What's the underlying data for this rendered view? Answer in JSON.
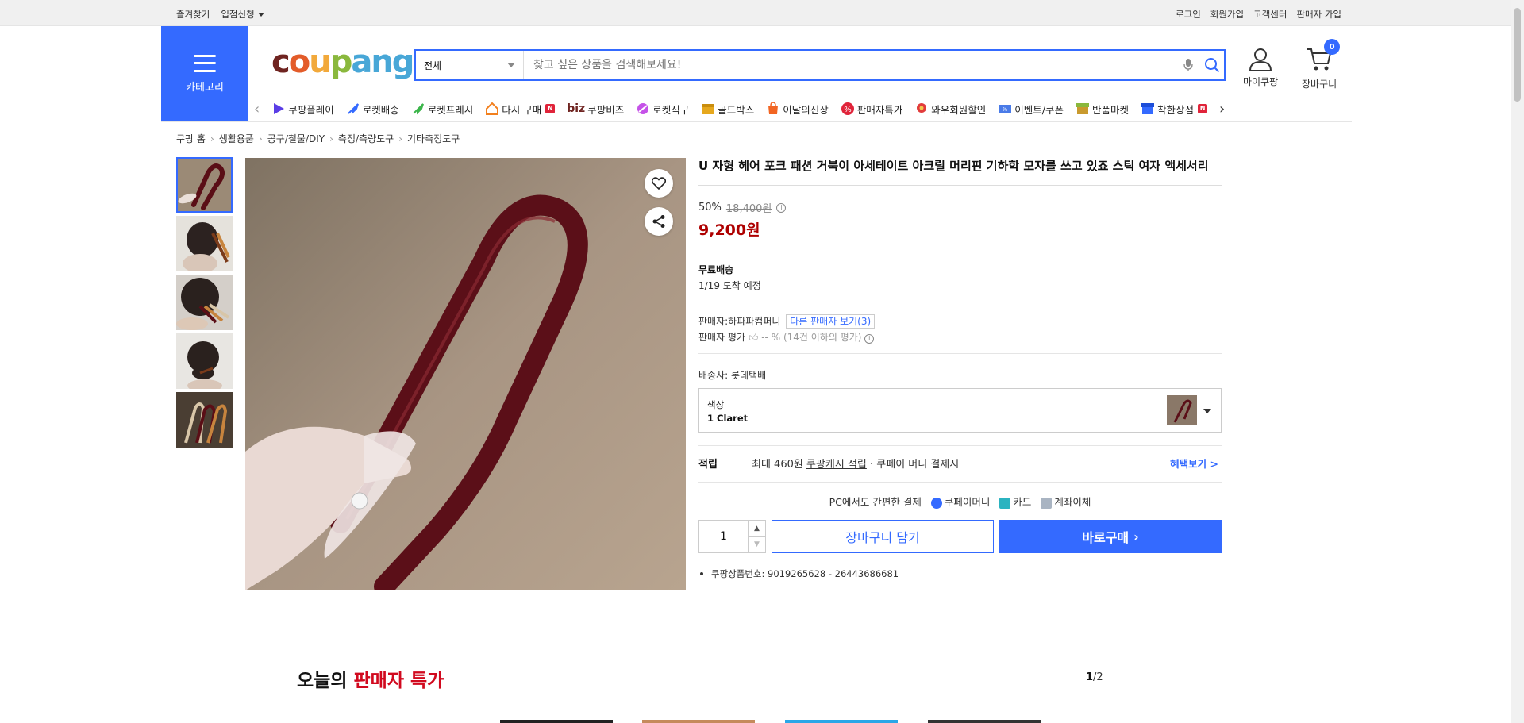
{
  "topbar": {
    "left": [
      "즐겨찾기",
      "입점신청"
    ],
    "right": [
      "로그인",
      "회원가입",
      "고객센터",
      "판매자 가입"
    ]
  },
  "header": {
    "category_label": "카테고리",
    "logo": "coupang",
    "search_scope": "전체",
    "search_placeholder": "찾고 싶은 상품을 검색해보세요!",
    "mypage_label": "마이쿠팡",
    "cart_label": "장바구니",
    "cart_count": "0"
  },
  "gnb": [
    {
      "label": "쿠팡플레이",
      "icon": "play-icon",
      "color": "#5a3de6"
    },
    {
      "label": "로켓배송",
      "icon": "rocket-icon",
      "color": "#346aff"
    },
    {
      "label": "로켓프레시",
      "icon": "rocket-fresh-icon",
      "color": "#3bb54a"
    },
    {
      "label": "다시 구매",
      "icon": "home-icon",
      "color": "#f2801e",
      "badge": "N"
    },
    {
      "label": "쿠팡비즈",
      "icon": "biz-icon",
      "color": "#6f2421",
      "prefix": "biz"
    },
    {
      "label": "로켓직구",
      "icon": "globe-icon",
      "color": "#c552e8"
    },
    {
      "label": "골드박스",
      "icon": "goldbox-icon",
      "color": "#e6a81e"
    },
    {
      "label": "이달의신상",
      "icon": "new-icon",
      "color": "#f26522"
    },
    {
      "label": "판매자특가",
      "icon": "percent-icon",
      "color": "#e0243a"
    },
    {
      "label": "와우회원할인",
      "icon": "wow-icon",
      "color": "#e23b3b"
    },
    {
      "label": "이벤트/쿠폰",
      "icon": "coupon-icon",
      "color": "#4a7be8"
    },
    {
      "label": "반품마켓",
      "icon": "market-icon",
      "color": "#c99a2e"
    },
    {
      "label": "착한상점",
      "icon": "store-icon",
      "color": "#346aff",
      "badge": "N"
    }
  ],
  "breadcrumb": [
    "쿠팡 홈",
    "생활용품",
    "공구/철물/DIY",
    "측정/측량도구",
    "기타측정도구"
  ],
  "product": {
    "title": "U 자형 헤어 포크 패션 거북이 아세테이트 아크릴 머리핀 기하학 모자를 쓰고 있죠 스틱 여자 액세서리",
    "discount": "50%",
    "original_price": "18,400원",
    "sale_price": "9,200원",
    "shipping_title": "무료배송",
    "arrival": "1/19 도착 예정",
    "seller_label": "판매자:",
    "seller_name": "하파파컴퍼니",
    "other_sellers": "다른 판매자 보기(3)",
    "seller_rating_label": "판매자 평가",
    "seller_rating_value": "-- %",
    "seller_rating_note": "(14건 이하의 평가)",
    "carrier_label": "배송사:",
    "carrier": "롯데택배",
    "option_label": "색상",
    "option_value": "1 Claret",
    "reward_label": "적립",
    "reward_text": "최대 460원",
    "reward_link": "쿠팡캐시 적립",
    "reward_suffix": "· 쿠페이 머니 결제시",
    "reward_more": "혜택보기 >",
    "pay_intro": "PC에서도 간편한 결제",
    "pay_methods": [
      "쿠페이머니",
      "카드",
      "계좌이체"
    ],
    "quantity": "1",
    "cart_button": "장바구니 담기",
    "buy_button": "바로구매",
    "product_id": "쿠팡상품번호: 9019265628 - 26443686681"
  },
  "deals": {
    "title_prefix": "오늘의",
    "title_highlight": "판매자 특가",
    "page_current": "1",
    "page_total": "/2"
  }
}
